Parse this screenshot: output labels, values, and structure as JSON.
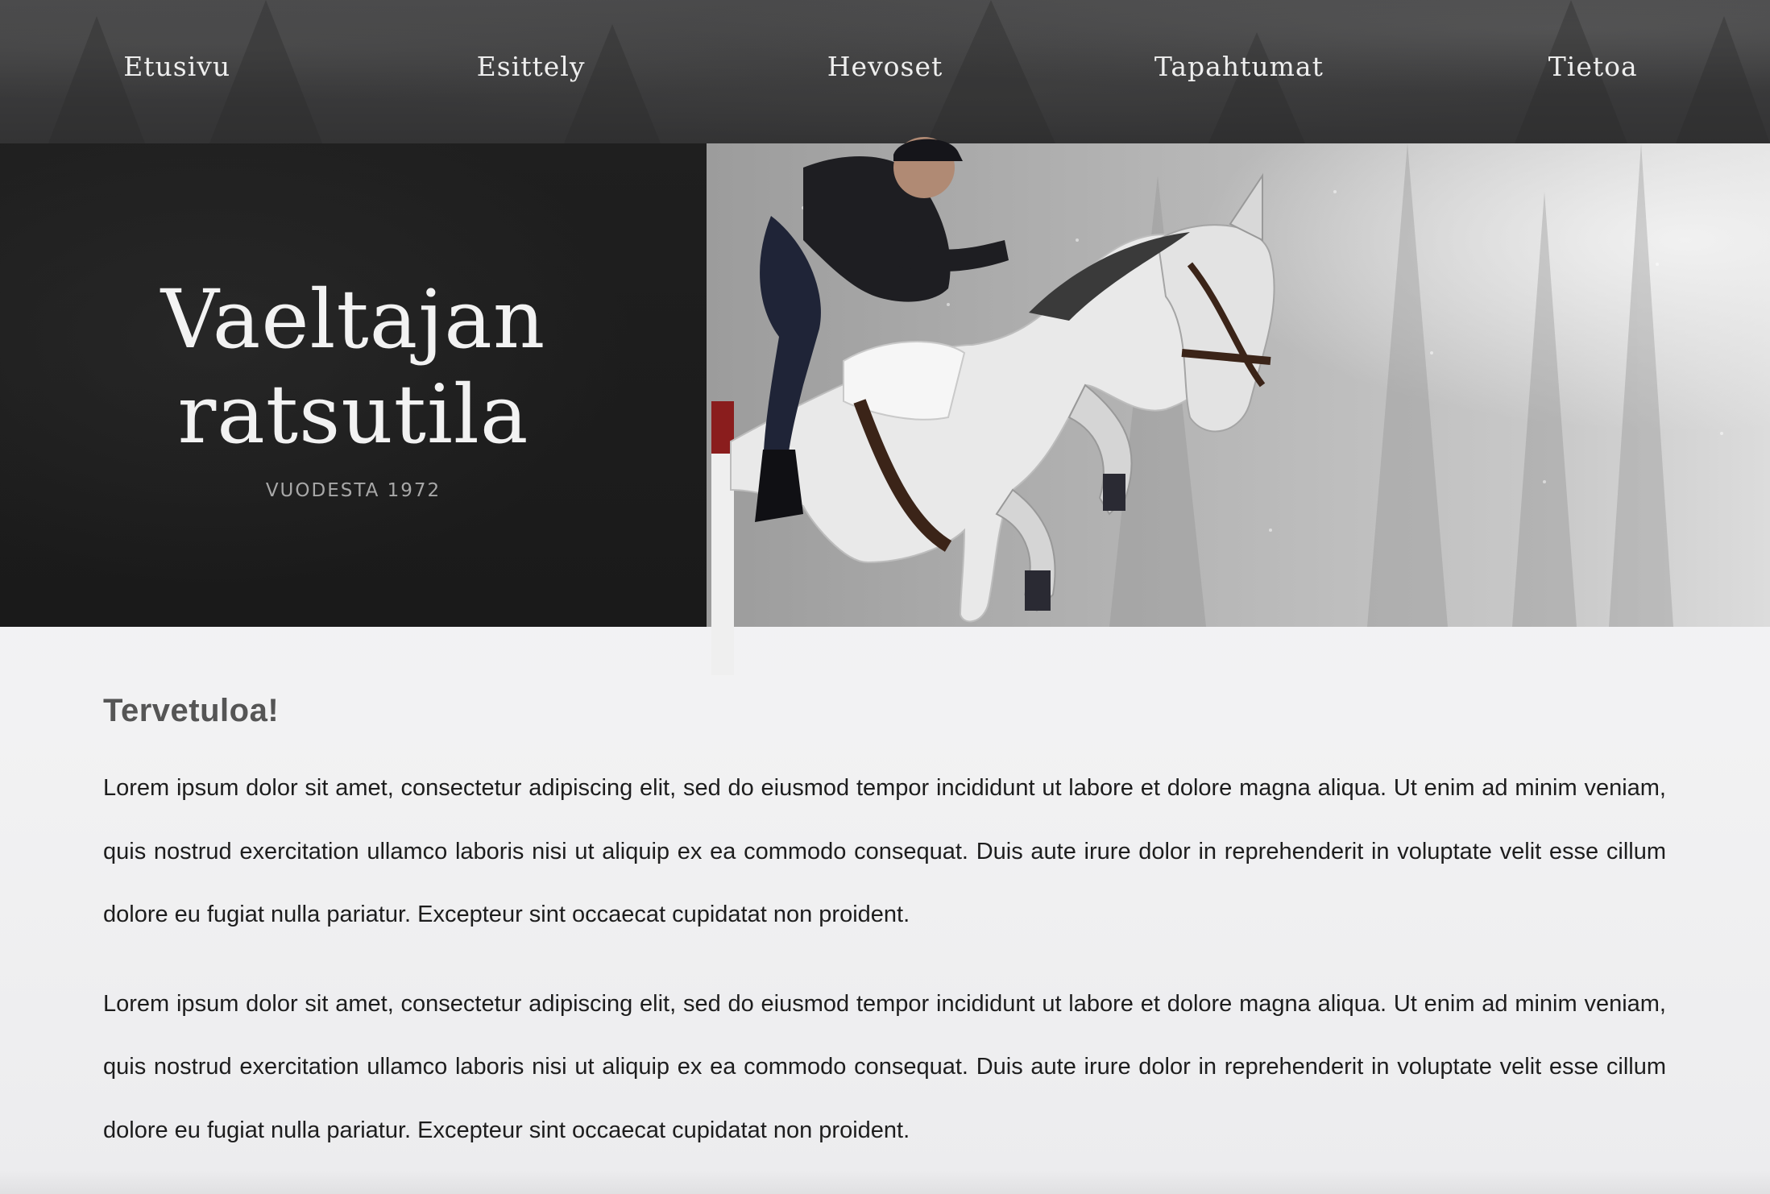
{
  "nav": {
    "items": [
      "Etusivu",
      "Esittely",
      "Hevoset",
      "Tapahtumat",
      "Tietoa"
    ]
  },
  "hero": {
    "title_line1": "Vaeltajan",
    "title_line2": "ratsutila",
    "subtitle": "VUODESTA 1972",
    "image_alt": "rider-jumping-horse-photo"
  },
  "main": {
    "heading": "Tervetuloa!",
    "paragraphs": [
      "Lorem ipsum dolor sit amet, consectetur adipiscing elit, sed do eiusmod tempor incididunt ut labore et dolore magna aliqua. Ut enim ad minim veniam, quis nostrud exercitation ullamco laboris nisi ut aliquip ex ea commodo consequat. Duis aute irure dolor in reprehenderit in voluptate velit esse cillum dolore eu fugiat nulla pariatur. Excepteur sint occaecat cupidatat non proident.",
      "Lorem ipsum dolor sit amet, consectetur adipiscing elit, sed do eiusmod tempor incididunt ut labore et dolore magna aliqua. Ut enim ad minim veniam, quis nostrud exercitation ullamco laboris nisi ut aliquip ex ea commodo consequat. Duis aute irure dolor in reprehenderit in voluptate velit esse cillum dolore eu fugiat nulla pariatur. Excepteur sint occaecat cupidatat non proident."
    ]
  },
  "colors": {
    "nav_bg": "#3b3b3c",
    "hero_dark": "#1c1c1c",
    "text": "#1d1d1d",
    "heading": "#555555"
  }
}
